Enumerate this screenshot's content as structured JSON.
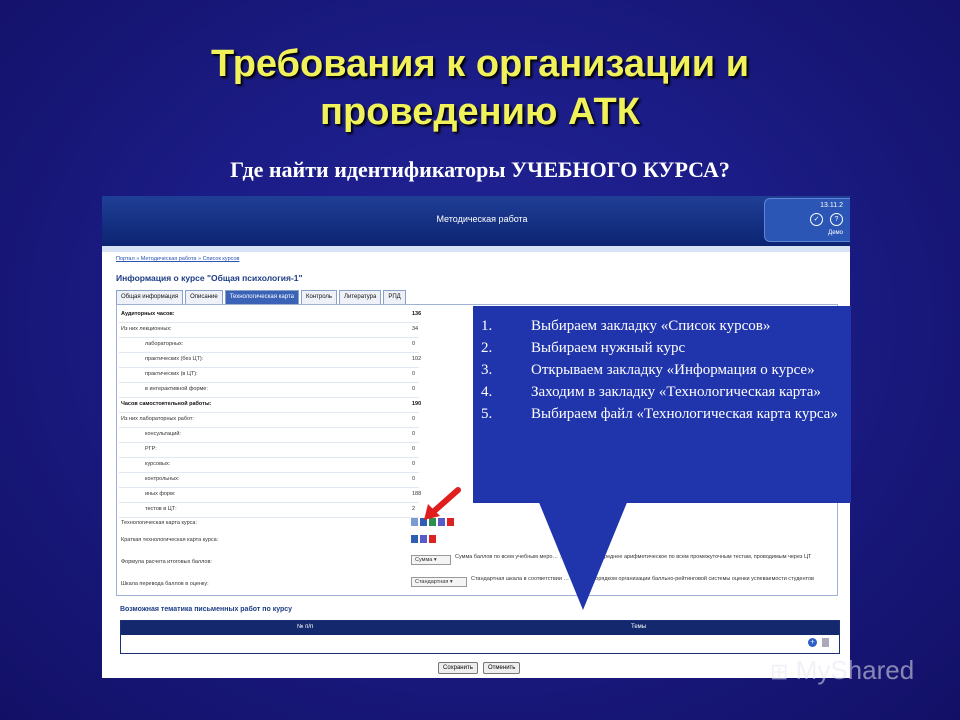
{
  "slide": {
    "title_line1": "Требования к организации и",
    "title_line2": "проведению АТК",
    "subtitle": "Где найти идентификаторы УЧЕБНОГО КУРСА?"
  },
  "app": {
    "header_title": "Методическая работа",
    "date": "13.11.2",
    "user": "Демо"
  },
  "breadcrumb": "Портал » Методическая работа » Список курсов",
  "course_title": "Информация о курсе \"Общая психология-1\"",
  "tabs": [
    "Общая информация",
    "Описание",
    "Технологическая карта",
    "Контроль",
    "Литература",
    "РПД"
  ],
  "rows": [
    {
      "label": "Аудиторных часов:",
      "value": "136"
    },
    {
      "label": "Из них лекционных:",
      "value": "34"
    },
    {
      "label": "лабораторных:",
      "value": "0"
    },
    {
      "label": "практических (без ЦТ):",
      "value": "102"
    },
    {
      "label": "практических (в ЦТ):",
      "value": "0"
    },
    {
      "label": "в интерактивной форме:",
      "value": "0"
    },
    {
      "label": "Часов самостоятельной работы:",
      "value": "190"
    },
    {
      "label": "Из них лабораторных работ:",
      "value": "0"
    },
    {
      "label": "консультаций:",
      "value": "0"
    },
    {
      "label": "РГР:",
      "value": "0"
    },
    {
      "label": "курсовых:",
      "value": "0"
    },
    {
      "label": "контрольных:",
      "value": "0"
    },
    {
      "label": "иных форм:",
      "value": "188"
    },
    {
      "label": "тестов в ЦТ:",
      "value": "2"
    }
  ],
  "extra": {
    "tech_map_label": "Технологическая карта курса:",
    "short_map_label": "Краткая технологическая карта курса:",
    "formula_label": "Формула расчета итоговых баллов:",
    "formula_select": "Сумма",
    "formula_desc": "Сумма баллов по всем учебным меро… …ный в курсе + среднее арифметическое по всем промежуточным тестам, проводимым через ЦТ",
    "scale_label": "Шкала перевода баллов в оценку:",
    "scale_select": "Стандартная",
    "scale_desc": "Стандартная шкала в соответствии … …нным Порядком организации балльно-рейтинговой системы оценки успеваемости студентов"
  },
  "themes": {
    "title": "Возможная тематика письменных работ по курсу",
    "col_num": "№ п/п",
    "col_theme": "Темы"
  },
  "buttons": {
    "save": "Сохранить",
    "cancel": "Отменить"
  },
  "callout": {
    "steps": [
      {
        "num": "1.",
        "text": "Выбираем закладку «Список курсов»"
      },
      {
        "num": "2.",
        "text": "Выбираем нужный курс"
      },
      {
        "num": "3.",
        "text": "Открываем закладку «Информация о курсе»"
      },
      {
        "num": "4.",
        "text": "Заходим в закладку «Технологическая карта»"
      },
      {
        "num": "5.",
        "text": "Выбираем файл «Технологическая карта курса»"
      }
    ]
  },
  "watermark": "MyShared",
  "colors": {
    "title": "#f1f15a",
    "callout": "#2035ac",
    "header": "#0c2472",
    "arrow": "#e01e1e"
  }
}
